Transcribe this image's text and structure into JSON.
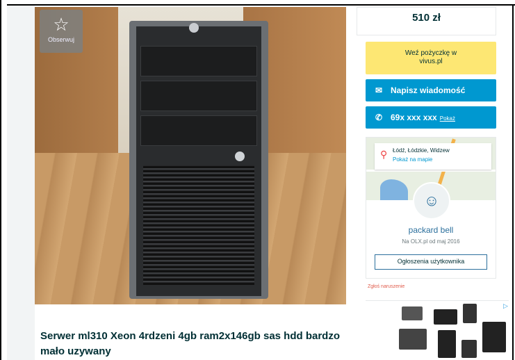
{
  "listing": {
    "title_line1": "Serwer ml310 Xeon 4rdzeni 4gb ram2x146gb sas hdd bardzo",
    "title_line2": "mało uzywany",
    "watch_label": "Obserwuj"
  },
  "sidebar": {
    "price": "510 zł",
    "loan_line1": "Weź pożyczkę w",
    "loan_line2": "vivus.pl",
    "message_button": "Napisz wiadomość",
    "phone_number": "69x xxx xxx",
    "phone_show": "Pokaż",
    "location": "Łódź, Łódzkie, Widzew",
    "show_on_map": "Pokaż na mapie",
    "username": "packard bell",
    "member_since": "Na OLX.pl od maj 2016",
    "user_ads_button": "Ogłoszenia użytkownika",
    "report": "Zgłoś naruszenie"
  },
  "colors": {
    "accent": "#0098d0",
    "loan_bg": "#fde773",
    "text_dark": "#002f34",
    "report_red": "#e05a4a"
  },
  "icons": {
    "star": "star-icon",
    "envelope": "envelope-icon",
    "phone": "phone-icon",
    "pin": "location-pin-icon",
    "user": "user-icon",
    "ad_choices": "ad-choices-icon"
  }
}
